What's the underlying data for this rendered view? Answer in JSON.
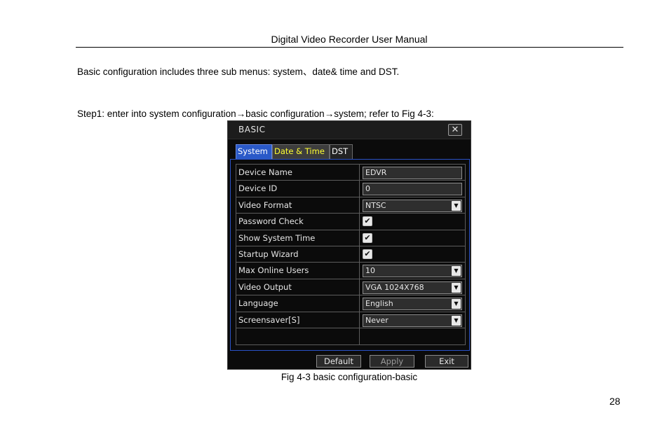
{
  "header": {
    "title": "Digital Video Recorder User Manual"
  },
  "intro": "Basic configuration includes three sub menus: system、date& time and DST.",
  "step": "Step1: enter into system configuration→basic configuration→system; refer to Fig 4-3:",
  "dialog": {
    "title": "BASIC",
    "close_glyph": "✕",
    "tabs": [
      {
        "label": "System"
      },
      {
        "label": "Date & Time"
      },
      {
        "label": "DST"
      }
    ],
    "rows": [
      {
        "label": "Device Name",
        "value": "EDVR"
      },
      {
        "label": "Device ID",
        "value": "0"
      },
      {
        "label": "Video Format",
        "value": "NTSC"
      },
      {
        "label": "Password Check",
        "checked": "✔"
      },
      {
        "label": "Show System Time",
        "checked": "✔"
      },
      {
        "label": "Startup Wizard",
        "checked": "✔"
      },
      {
        "label": "Max Online Users",
        "value": "10"
      },
      {
        "label": "Video Output",
        "value": "VGA 1024X768"
      },
      {
        "label": "Language",
        "value": "English"
      },
      {
        "label": "Screensaver[S]",
        "value": "Never"
      },
      {
        "label": ""
      }
    ],
    "drop_glyph": "▼",
    "buttons": {
      "default": "Default",
      "apply": "Apply",
      "exit": "Exit"
    }
  },
  "caption": "Fig 4-3 basic configuration-basic",
  "page_number": "28"
}
